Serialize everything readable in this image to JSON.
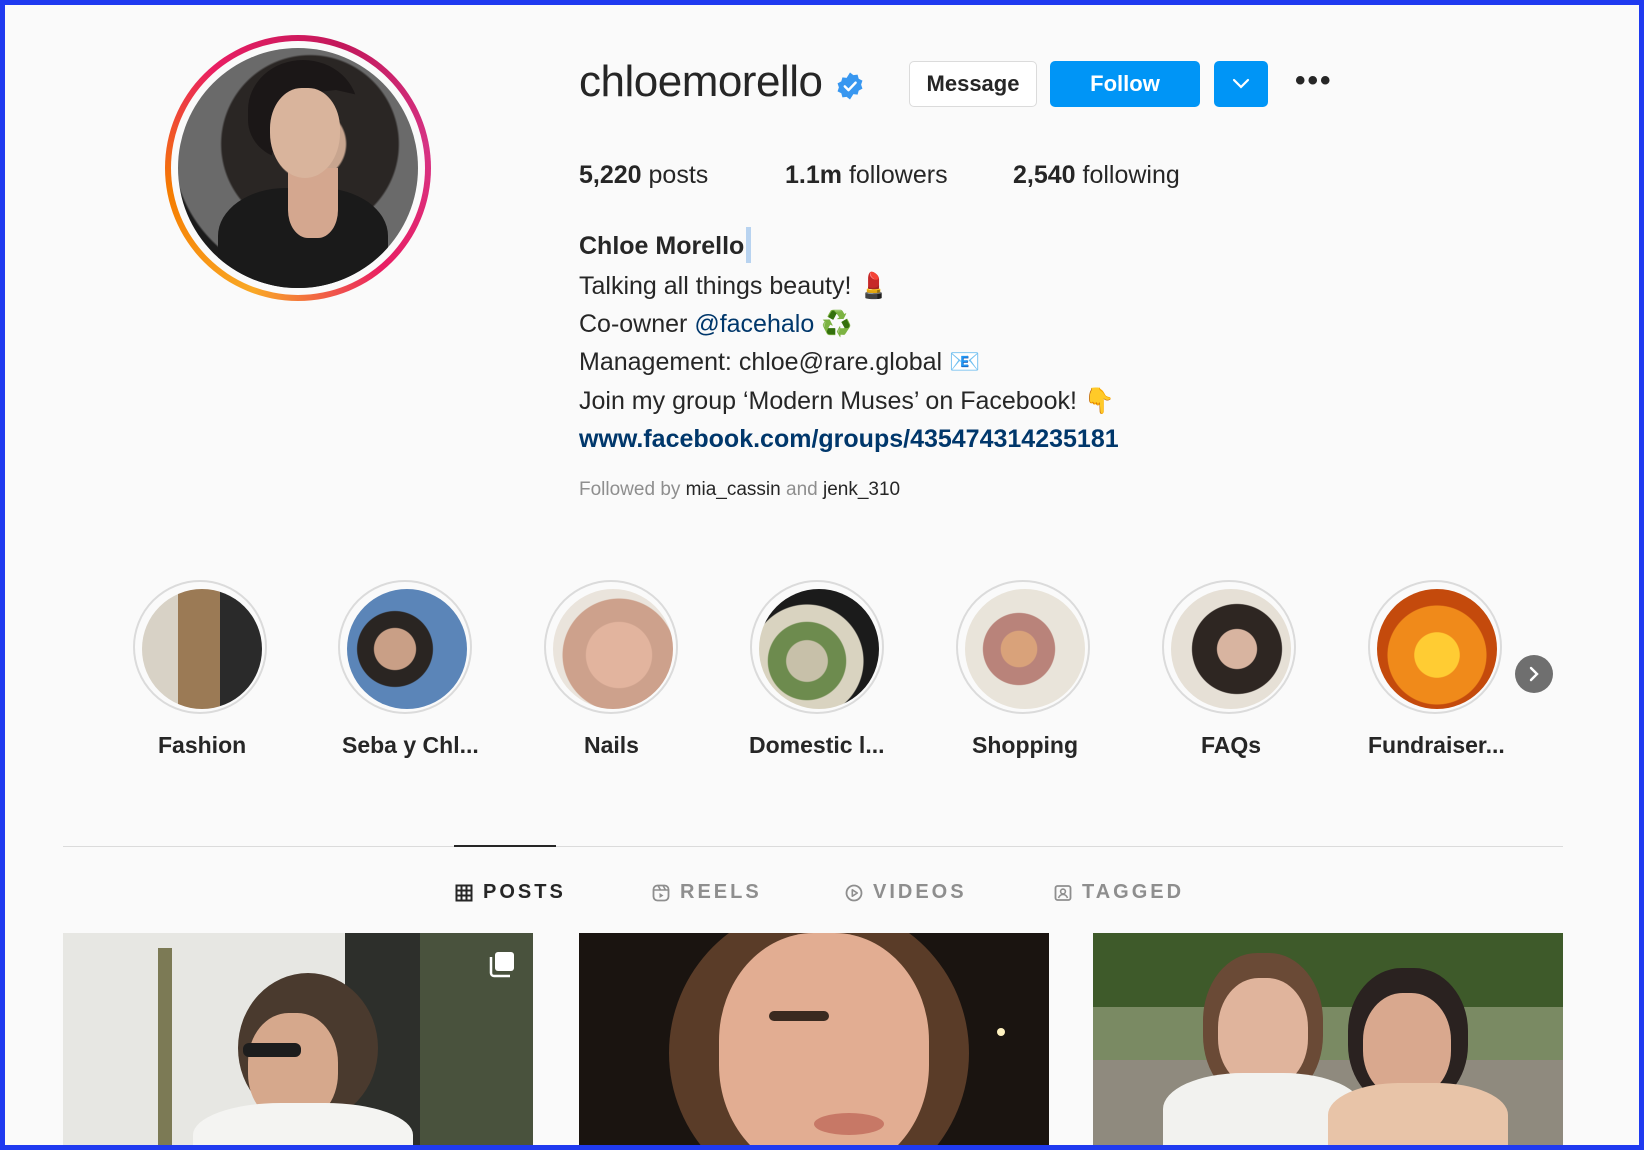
{
  "profile": {
    "username": "chloemorello",
    "verified_icon": "verified-badge-icon",
    "buttons": {
      "message": "Message",
      "follow": "Follow"
    },
    "more_label": "•••",
    "stats": {
      "posts_count": "5,220",
      "posts_label": "posts",
      "followers_count": "1.1m",
      "followers_label": "followers",
      "following_count": "2,540",
      "following_label": "following"
    },
    "bio": {
      "name": "Chloe Morello",
      "line1": "Talking all things beauty! 💄",
      "line2_prefix": "Co-owner ",
      "line2_mention": "@facehalo",
      "line2_suffix": " ♻️",
      "line3": "Management: chloe@rare.global 📧",
      "line4": "Join my group ‘Modern Muses’ on Facebook! 👇",
      "link": "www.facebook.com/groups/435474314235181"
    },
    "followed_by": {
      "prefix": "Followed by",
      "user1": "mia_cassin",
      "conj": "and",
      "user2": "jenk_310"
    }
  },
  "highlights": [
    {
      "label": "Fashion"
    },
    {
      "label": "Seba y Chl..."
    },
    {
      "label": "Nails"
    },
    {
      "label": "Domestic l..."
    },
    {
      "label": "Shopping"
    },
    {
      "label": "FAQs"
    },
    {
      "label": "Fundraiser..."
    }
  ],
  "tabs": [
    {
      "label": "POSTS",
      "icon": "grid-icon",
      "active": true
    },
    {
      "label": "REELS",
      "icon": "reels-icon",
      "active": false
    },
    {
      "label": "VIDEOS",
      "icon": "play-icon",
      "active": false
    },
    {
      "label": "TAGGED",
      "icon": "tagged-icon",
      "active": false
    }
  ],
  "colors": {
    "accent": "#0095f6",
    "frame": "#1f3af0",
    "link": "#00376b",
    "muted": "#8e8e8e"
  }
}
